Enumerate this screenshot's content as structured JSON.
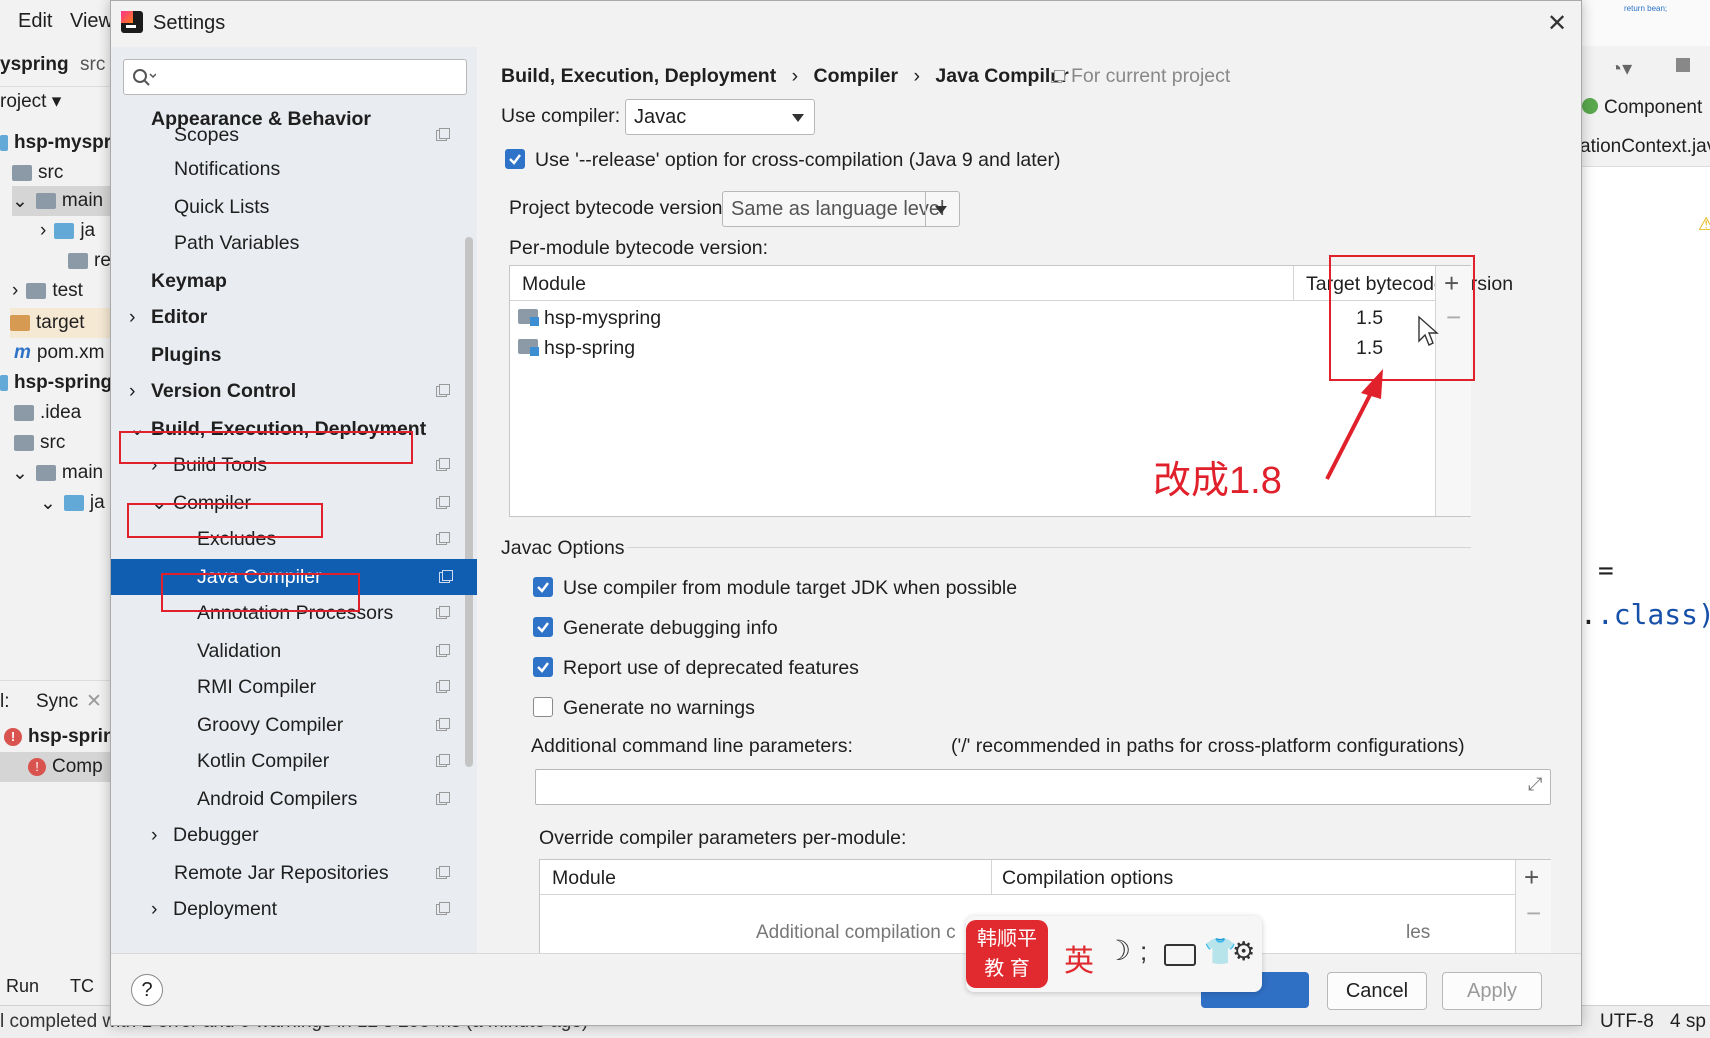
{
  "ide": {
    "menu": [
      "Edit",
      "View"
    ],
    "breadcrumb": [
      "yspring",
      "src"
    ],
    "project_label": "roject",
    "tree": [
      "hsp-myspr",
      "src",
      "main",
      "ja",
      "re",
      "test",
      "target",
      "pom.xm",
      "hsp-spring",
      ".idea",
      "src",
      "main",
      "ja"
    ],
    "bottom_tabs": [
      "l:",
      "Sync"
    ],
    "bottom_tree": [
      "hsp-sprin",
      "Comp"
    ],
    "run_tab": "Run",
    "todo_tab": "TC",
    "status_text": "l completed with 1 error and 0 warnings in 12 s 258 ms (a minute ago)",
    "status_encoding": "UTF-8",
    "status_indent": "4 sp",
    "right_tab_component": "Component",
    "right_tab_context": "ationContext.jav",
    "code_eq": "=",
    "code_class": ".class);",
    "preview_text": "return bean;"
  },
  "dialog": {
    "title": "Settings",
    "search_placeholder": "",
    "sidebar": {
      "items": [
        {
          "label": "Appearance & Behavior"
        },
        {
          "label": "Scopes"
        },
        {
          "label": "Notifications"
        },
        {
          "label": "Quick Lists"
        },
        {
          "label": "Path Variables"
        },
        {
          "label": "Keymap"
        },
        {
          "label": "Editor"
        },
        {
          "label": "Plugins"
        },
        {
          "label": "Version Control"
        },
        {
          "label": "Build, Execution, Deployment"
        },
        {
          "label": "Build Tools"
        },
        {
          "label": "Compiler"
        },
        {
          "label": "Excludes"
        },
        {
          "label": "Java Compiler"
        },
        {
          "label": "Annotation Processors"
        },
        {
          "label": "Validation"
        },
        {
          "label": "RMI Compiler"
        },
        {
          "label": "Groovy Compiler"
        },
        {
          "label": "Kotlin Compiler"
        },
        {
          "label": "Android Compilers"
        },
        {
          "label": "Debugger"
        },
        {
          "label": "Remote Jar Repositories"
        },
        {
          "label": "Deployment"
        }
      ]
    },
    "breadcrumb": [
      "Build, Execution, Deployment",
      "Compiler",
      "Java Compiler"
    ],
    "breadcrumb_sep": "›",
    "for_current_project": "For current project",
    "use_compiler_label": "Use compiler:",
    "use_compiler_value": "Javac",
    "release_option_label": "Use '--release' option for cross-compilation (Java 9 and later)",
    "release_option_checked": true,
    "project_bytecode_label": "Project bytecode version:",
    "project_bytecode_value": "Same as language level",
    "per_module_label": "Per-module bytecode version:",
    "module_table": {
      "headers": [
        "Module",
        "Target bytecode version"
      ],
      "rows": [
        {
          "module": "hsp-myspring",
          "version": "1.5"
        },
        {
          "module": "hsp-spring",
          "version": "1.5"
        }
      ]
    },
    "annotation_text": "改成1.8",
    "javac_options_title": "Javac Options",
    "javac_options": [
      {
        "label": "Use compiler from module target JDK when possible",
        "checked": true
      },
      {
        "label": "Generate debugging info",
        "checked": true
      },
      {
        "label": "Report use of deprecated features",
        "checked": true
      },
      {
        "label": "Generate no warnings",
        "checked": false
      }
    ],
    "additional_params_label": "Additional command line parameters:",
    "additional_params_hint": "('/' recommended in paths for cross-platform configurations)",
    "additional_params_value": "",
    "override_label": "Override compiler parameters per-module:",
    "override_table": {
      "headers": [
        "Module",
        "Compilation options"
      ],
      "empty_text_left": "Additional compilation c",
      "empty_text_right": "les"
    },
    "buttons": {
      "help": "?",
      "cancel": "Cancel",
      "apply": "Apply"
    }
  },
  "ime": {
    "logo_line1": "韩顺平",
    "logo_line2": "教 育",
    "lang": "英"
  },
  "colors": {
    "selection": "#0f5eb1",
    "annotation_red": "#e0202a",
    "checkbox_blue": "#2e73c8"
  }
}
